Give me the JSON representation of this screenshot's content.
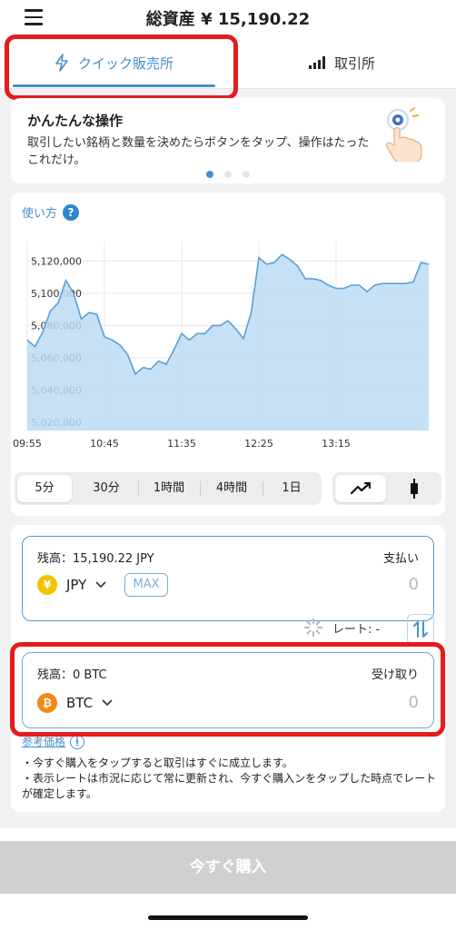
{
  "header": {
    "title": "総資産 ¥ 15,190.22",
    "menu_icon": "hamburger-menu-icon"
  },
  "tabs": [
    {
      "label": "クイック販売所",
      "icon": "lightning-icon",
      "active": true
    },
    {
      "label": "取引所",
      "icon": "signal-bars-icon",
      "active": false
    }
  ],
  "info": {
    "title": "かんたんな操作",
    "description": "取引したい銘柄と数量を決めたらボタンをタップ、操作はたったこれだけ。",
    "icon": "tap-gesture-icon",
    "page_count": 3,
    "active_page": 1
  },
  "chart_panel": {
    "howto_label": "使い方",
    "help_icon": "?"
  },
  "chart_data": {
    "type": "area",
    "x": [
      "09:55",
      "10:00",
      "10:05",
      "10:10",
      "10:15",
      "10:20",
      "10:25",
      "10:30",
      "10:35",
      "10:40",
      "10:45",
      "10:50",
      "10:55",
      "11:00",
      "11:05",
      "11:10",
      "11:15",
      "11:20",
      "11:25",
      "11:30",
      "11:35",
      "11:40",
      "11:45",
      "11:50",
      "11:55",
      "12:00",
      "12:05",
      "12:10",
      "12:15",
      "12:20",
      "12:25",
      "12:30",
      "12:35",
      "12:40",
      "12:45",
      "12:50",
      "12:55",
      "13:00",
      "13:05",
      "13:10",
      "13:15",
      "13:20",
      "13:25",
      "13:30",
      "13:35",
      "13:40",
      "13:45",
      "13:50",
      "13:55",
      "14:00"
    ],
    "y": [
      5071000,
      5067000,
      5076000,
      5089000,
      5094000,
      5108000,
      5100000,
      5084000,
      5088000,
      5087000,
      5073000,
      5071000,
      5068000,
      5062000,
      5050000,
      5054000,
      5053000,
      5058000,
      5056000,
      5065000,
      5075000,
      5071000,
      5075000,
      5075000,
      5080000,
      5080000,
      5083000,
      5078000,
      5072000,
      5088000,
      5122000,
      5118000,
      5119000,
      5124000,
      5121000,
      5117000,
      5109000,
      5109000,
      5108000,
      5105000,
      5103000,
      5103000,
      5105000,
      5105000,
      5101000,
      5105000,
      5106000,
      5106000,
      5106000,
      5106000,
      5107000,
      5119000,
      5118000
    ],
    "x_ticks": [
      "09:55",
      "10:45",
      "11:35",
      "12:25",
      "13:15"
    ],
    "y_ticks": [
      "5,020,000",
      "5,040,000",
      "5,060,000",
      "5,080,000",
      "5,100,000",
      "5,120,000"
    ],
    "ylim": [
      5015000,
      5132000
    ],
    "grid": true,
    "color": "#5a9fd8",
    "fill": "#bcdcf4"
  },
  "ranges": [
    {
      "label": "5分",
      "active": true
    },
    {
      "label": "30分",
      "active": false
    },
    {
      "label": "1時間",
      "active": false
    },
    {
      "label": "4時間",
      "active": false
    },
    {
      "label": "1日",
      "active": false
    }
  ],
  "chart_types": [
    {
      "icon": "line-chart-icon",
      "active": true
    },
    {
      "icon": "candlestick-icon",
      "active": false
    }
  ],
  "pay": {
    "balance": "残高：15,190.22 JPY",
    "label": "支払い",
    "currency": "JPY",
    "coin_symbol": "¥",
    "coin_color": "#f2c300",
    "max_label": "MAX",
    "amount_placeholder": "0"
  },
  "rate": {
    "label": "レート: -"
  },
  "receive": {
    "balance": "残高：0 BTC",
    "label": "受け取り",
    "currency": "BTC",
    "coin_symbol": "₿",
    "coin_color": "#f08a1c",
    "amount_placeholder": "0"
  },
  "reference": {
    "label": "参考価格"
  },
  "notes": [
    "・今すぐ購入をタップすると取引はすぐに成立します。",
    "・表示レートは市況に応じて常に更新され、今すぐ購入ンをタップした時点でレートが確定します。"
  ],
  "footer": {
    "buy_label": "今すぐ購入"
  },
  "colors": {
    "accent": "#4a90c8",
    "highlight": "#e41c1c",
    "button_disabled": "#d0d0d2"
  }
}
